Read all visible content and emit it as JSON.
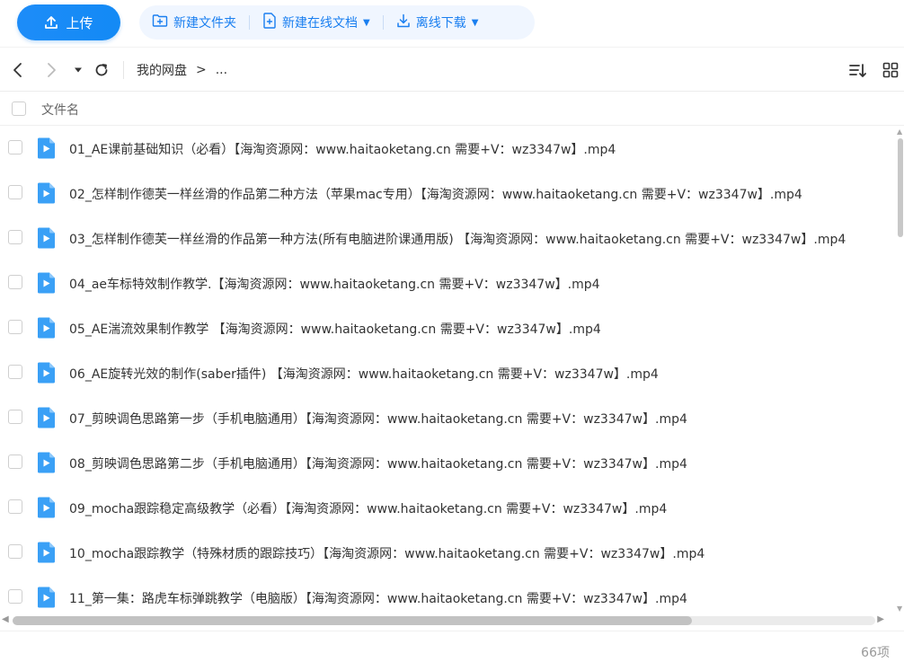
{
  "toolbar": {
    "upload_label": "上传",
    "new_folder_label": "新建文件夹",
    "new_online_doc_label": "新建在线文档",
    "offline_download_label": "离线下载"
  },
  "colors": {
    "accent": "#1a7ff0",
    "upload_bg": "#1d8cf8",
    "action_group_bg": "#f0f6ff",
    "video_icon": "#3aa0f6"
  },
  "breadcrumb": {
    "root": "我的网盘",
    "arrow": ">",
    "ellipsis": "..."
  },
  "header": {
    "column_name": "文件名"
  },
  "files": [
    "01_AE课前基础知识（必看）【海淘资源网：www.haitaoketang.cn 需要+V：wz3347w】.mp4",
    "02_怎样制作德芙一样丝滑的作品第二种方法（苹果mac专用）【海淘资源网：www.haitaoketang.cn 需要+V：wz3347w】.mp4",
    "03_怎样制作德芙一样丝滑的作品第一种方法(所有电脑进阶课通用版) 【海淘资源网：www.haitaoketang.cn 需要+V：wz3347w】.mp4",
    "04_ae车标特效制作教学.【海淘资源网：www.haitaoketang.cn 需要+V：wz3347w】.mp4",
    "05_AE湍流效果制作教学 【海淘资源网：www.haitaoketang.cn 需要+V：wz3347w】.mp4",
    "06_AE旋转光效的制作(saber插件) 【海淘资源网：www.haitaoketang.cn 需要+V：wz3347w】.mp4",
    "07_剪映调色思路第一步（手机电脑通用）【海淘资源网：www.haitaoketang.cn 需要+V：wz3347w】.mp4",
    "08_剪映调色思路第二步（手机电脑通用）【海淘资源网：www.haitaoketang.cn 需要+V：wz3347w】.mp4",
    "09_mocha跟踪稳定高级教学（必看）【海淘资源网：www.haitaoketang.cn 需要+V：wz3347w】.mp4",
    "10_mocha跟踪教学（特殊材质的跟踪技巧）【海淘资源网：www.haitaoketang.cn 需要+V：wz3347w】.mp4",
    "11_第一集：路虎车标弹跳教学（电脑版）【海淘资源网：www.haitaoketang.cn 需要+V：wz3347w】.mp4"
  ],
  "footer": {
    "item_count": "66项"
  }
}
